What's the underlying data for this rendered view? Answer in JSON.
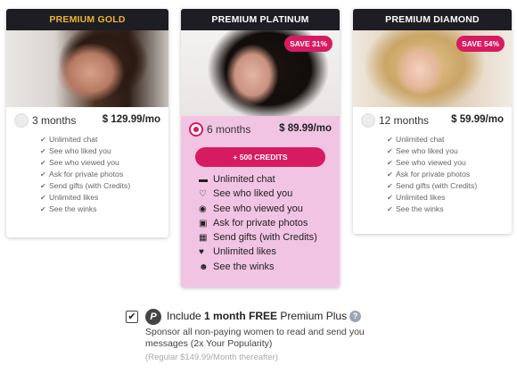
{
  "plans": {
    "gold": {
      "name": "PREMIUM GOLD",
      "duration": "3 months",
      "price": "$ 129.99/mo",
      "features": [
        "Unlimited chat",
        "See who liked you",
        "See who viewed you",
        "Ask for private photos",
        "Send gifts (with Credits)",
        "Unlimited likes",
        "See the winks"
      ]
    },
    "platinum": {
      "name": "PREMIUM PLATINUM",
      "badge": "SAVE 31%",
      "duration": "6 months",
      "price": "$ 89.99/mo",
      "credits_button": "+ 500 CREDITS",
      "selected": true,
      "features": [
        {
          "label": "Unlimited chat",
          "icon": "chat-icon"
        },
        {
          "label": "See who liked you",
          "icon": "heart-outline-icon"
        },
        {
          "label": "See who viewed you",
          "icon": "eye-icon"
        },
        {
          "label": "Ask for private photos",
          "icon": "lock-icon"
        },
        {
          "label": "Send gifts (with Credits)",
          "icon": "gift-icon"
        },
        {
          "label": "Unlimited likes",
          "icon": "heart-icon"
        },
        {
          "label": "See the winks",
          "icon": "wink-icon"
        }
      ]
    },
    "diamond": {
      "name": "PREMIUM DIAMOND",
      "badge": "SAVE 54%",
      "duration": "12 months",
      "price": "$ 59.99/mo",
      "features": [
        "Unlimited chat",
        "See who liked you",
        "See who viewed you",
        "Ask for private photos",
        "Send gifts (with Credits)",
        "Unlimited likes",
        "See the winks"
      ]
    }
  },
  "addon": {
    "checked": true,
    "title_prefix": "Include ",
    "title_bold": "1 month FREE",
    "title_suffix": " Premium Plus",
    "description": "Sponsor all non-paying women to read and send you messages (2x Your Popularity)",
    "note": "(Regular $149.99/Month thereafter)"
  },
  "colors": {
    "accent": "#d81b60",
    "gold_header_text": "#f0b330",
    "header_bg": "#1d1d23",
    "platinum_bg": "#f1c4e3"
  }
}
